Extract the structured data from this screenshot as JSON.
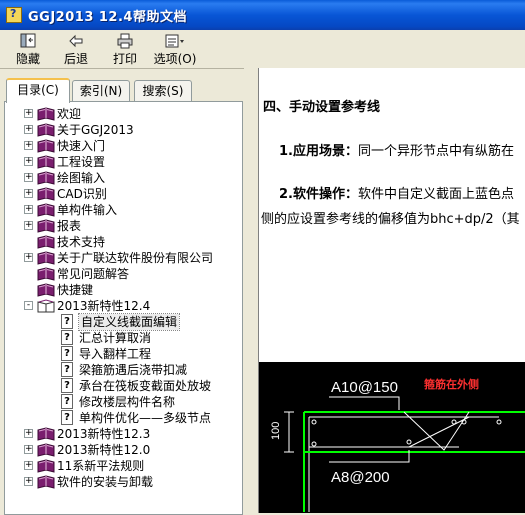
{
  "window": {
    "title": "GGJ2013 12.4帮助文档"
  },
  "toolbar": {
    "hide": "隐藏",
    "back": "后退",
    "print": "打印",
    "options": "选项(O)"
  },
  "tabs": {
    "contents": "目录(C)",
    "index": "索引(N)",
    "search": "搜索(S)"
  },
  "tree": [
    {
      "label": "欢迎"
    },
    {
      "label": "关于GGJ2013"
    },
    {
      "label": "快速入门"
    },
    {
      "label": "工程设置"
    },
    {
      "label": "绘图输入"
    },
    {
      "label": "CAD识别"
    },
    {
      "label": "单构件输入"
    },
    {
      "label": "报表"
    },
    {
      "label": "技术支持"
    },
    {
      "label": "关于广联达软件股份有限公司"
    },
    {
      "label": "常见问题解答"
    },
    {
      "label": "快捷键"
    },
    {
      "label": "2013新特性12.4"
    },
    {
      "label": "自定义线截面编辑"
    },
    {
      "label": "汇总计算取消"
    },
    {
      "label": "导入翻样工程"
    },
    {
      "label": "梁箍筋遇后浇带扣减"
    },
    {
      "label": "承台在筏板变截面处放坡"
    },
    {
      "label": "修改楼层构件名称"
    },
    {
      "label": "单构件优化——多级节点"
    },
    {
      "label": "2013新特性12.3"
    },
    {
      "label": "2013新特性12.0"
    },
    {
      "label": "11系新平法规则"
    },
    {
      "label": "软件的安装与卸载"
    }
  ],
  "content": {
    "heading": "四、手动设置参考线",
    "scene_label": "1.应用场景：",
    "scene_text": "同一个异形节点中有纵筋在",
    "op_label": "2.软件操作：",
    "op_text": "软件中自定义截面上蓝色点",
    "op_text2": "侧的应设置参考线的偏移值为bhc+dp/2（其",
    "drawing": {
      "label1": "A10@150",
      "label2": "A8@200",
      "dim": "100",
      "note": "箍筋在外侧"
    }
  },
  "colors": {
    "title_bar": "#0856d6",
    "book": "#7a1e6e",
    "cad_bg": "#000000",
    "cad_line": "#00ff00",
    "cad_text": "#ffffff",
    "cad_red": "#ff3030"
  }
}
